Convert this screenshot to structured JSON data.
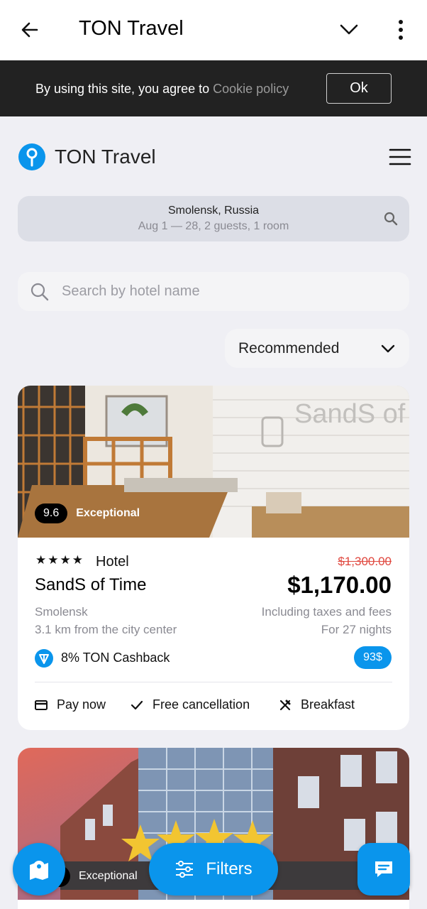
{
  "topbar": {
    "title": "TON Travel"
  },
  "cookie": {
    "text": "By using this site, you agree to ",
    "link": "Cookie policy",
    "ok_label": "Ok"
  },
  "brand": {
    "name": "TON Travel"
  },
  "search": {
    "location": "Smolensk, Russia",
    "details": "Aug 1 — 28, 2 guests, 1 room"
  },
  "hotel_search": {
    "placeholder": "Search by hotel name"
  },
  "sort": {
    "selected": "Recommended"
  },
  "hotels": [
    {
      "score": "9.6",
      "rating_word": "Exceptional",
      "stars": "★★★★",
      "type": "Hotel",
      "name": "SandS of Time",
      "city": "Smolensk",
      "distance": "3.1 km from the city center",
      "old_price": "$1,300.00",
      "price": "$1,170.00",
      "taxes_note": "Including taxes and fees",
      "nights": "For 27 nights",
      "cashback": "8% TON Cashback",
      "cashback_amount": "93$",
      "photo_sign": "SandS of time",
      "features": [
        "Pay now",
        "Free cancellation",
        "Breakfast"
      ]
    },
    {
      "rating_word": "Exceptional"
    }
  ],
  "fab": {
    "filters_label": "Filters"
  },
  "colors": {
    "accent": "#0a95ec",
    "sale": "#e0483f",
    "cookie_bg": "#222222"
  }
}
